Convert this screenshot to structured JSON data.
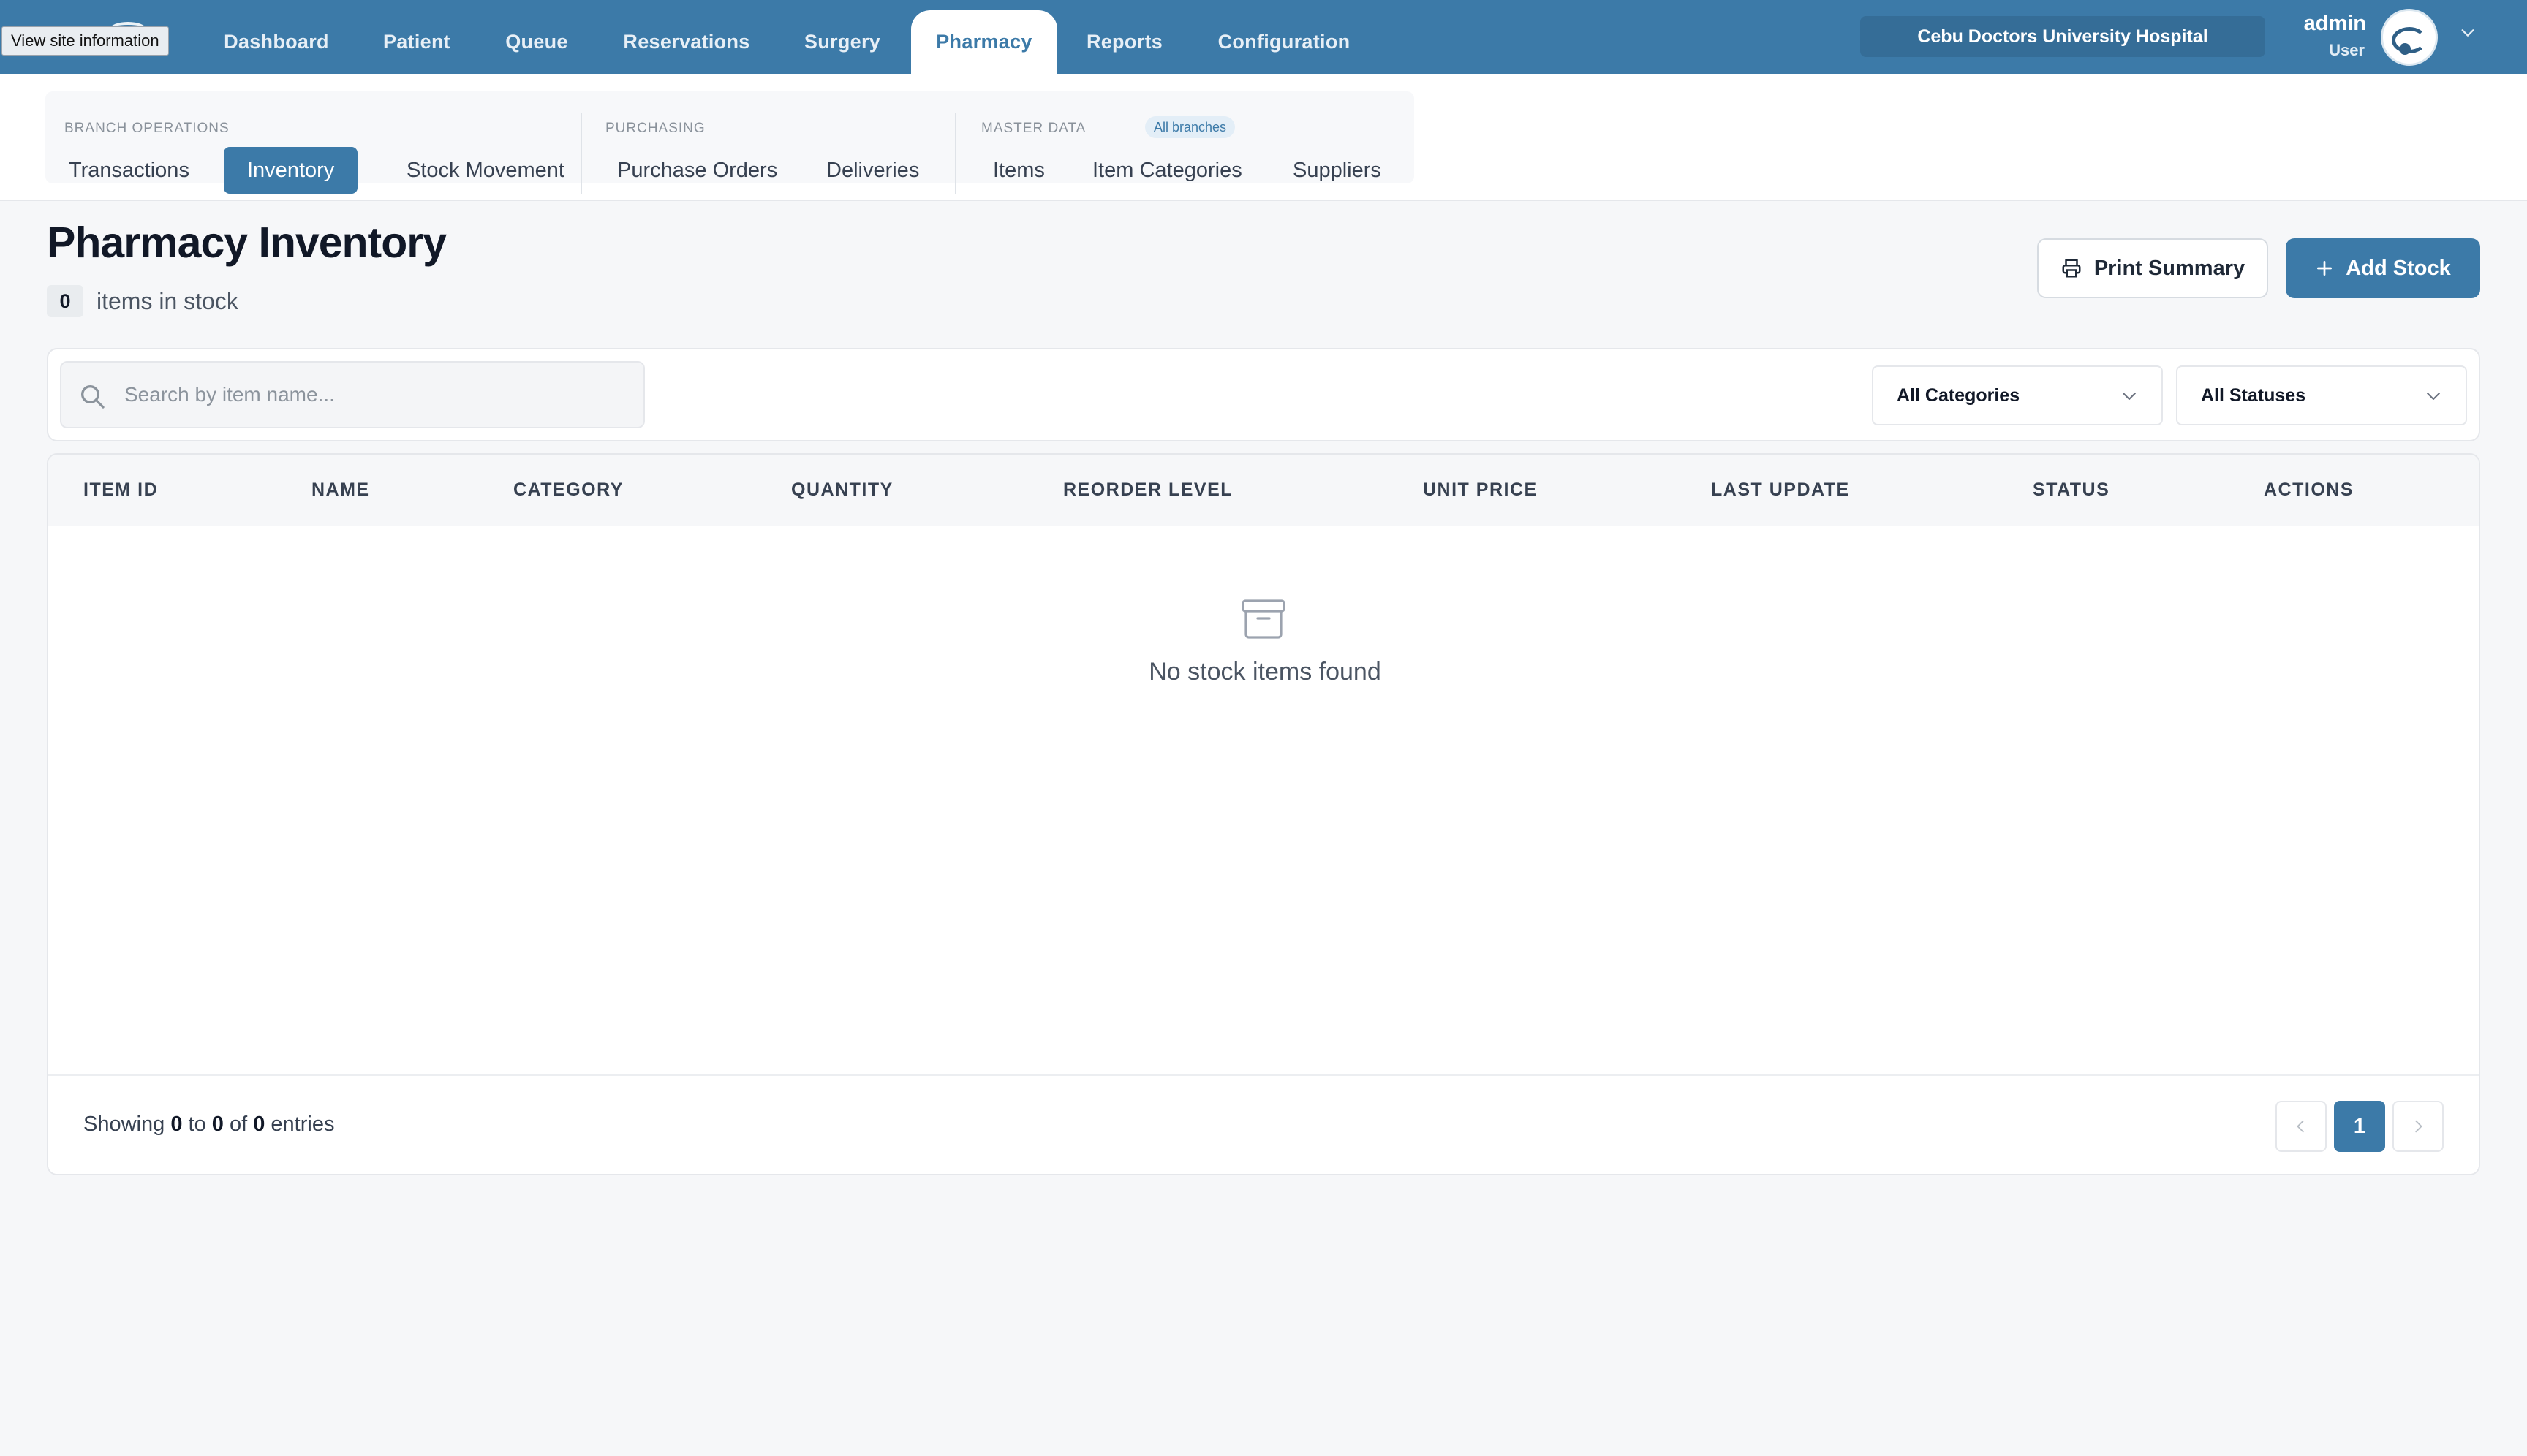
{
  "site_info_tooltip": "View site information",
  "nav": {
    "items": [
      {
        "label": "Dashboard"
      },
      {
        "label": "Patient"
      },
      {
        "label": "Queue"
      },
      {
        "label": "Reservations"
      },
      {
        "label": "Surgery"
      },
      {
        "label": "Pharmacy",
        "active": true
      },
      {
        "label": "Reports"
      },
      {
        "label": "Configuration"
      }
    ],
    "hospital": "Cebu Doctors University Hospital",
    "user": {
      "name": "admin",
      "role": "User"
    }
  },
  "subnav": {
    "groups": [
      {
        "label": "BRANCH OPERATIONS",
        "items": [
          "Transactions",
          "Inventory",
          "Stock Movement"
        ]
      },
      {
        "label": "PURCHASING",
        "items": [
          "Purchase Orders",
          "Deliveries"
        ]
      },
      {
        "label": "MASTER DATA",
        "badge": "All branches",
        "items": [
          "Items",
          "Item Categories",
          "Suppliers"
        ]
      }
    ],
    "active": "Inventory"
  },
  "page": {
    "title": "Pharmacy Inventory",
    "count": "0",
    "count_label": "items in stock",
    "print_button": "Print Summary",
    "add_button": "Add Stock"
  },
  "filters": {
    "search_placeholder": "Search by item name...",
    "category": "All Categories",
    "status": "All Statuses"
  },
  "table": {
    "columns": [
      "ITEM ID",
      "NAME",
      "CATEGORY",
      "QUANTITY",
      "REORDER LEVEL",
      "UNIT PRICE",
      "LAST UPDATE",
      "STATUS",
      "ACTIONS"
    ],
    "rows": [],
    "empty_text": "No stock items found"
  },
  "pagination": {
    "showing_prefix": "Showing",
    "from": "0",
    "to_word": "to",
    "to": "0",
    "of_word": "of",
    "total": "0",
    "suffix": "entries",
    "current_page": "1"
  },
  "colors": {
    "brand": "#3c7aa8",
    "background": "#f6f7f9"
  },
  "icons": [
    "printer-icon",
    "plus-icon",
    "search-icon",
    "chevron-down-icon",
    "archive-box-icon",
    "chevron-left-icon",
    "chevron-right-icon"
  ]
}
